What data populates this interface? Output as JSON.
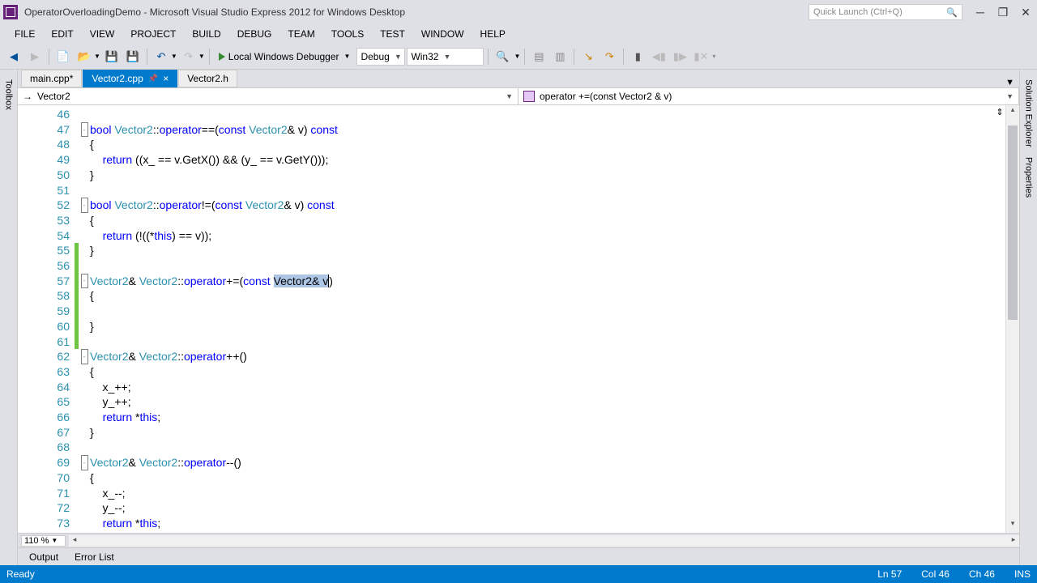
{
  "titlebar": {
    "title": "OperatorOverloadingDemo - Microsoft Visual Studio Express 2012 for Windows Desktop",
    "quicklaunch_placeholder": "Quick Launch (Ctrl+Q)"
  },
  "menu": [
    "FILE",
    "EDIT",
    "VIEW",
    "PROJECT",
    "BUILD",
    "DEBUG",
    "TEAM",
    "TOOLS",
    "TEST",
    "WINDOW",
    "HELP"
  ],
  "toolbar": {
    "debugger_label": "Local Windows Debugger",
    "config": "Debug",
    "platform": "Win32"
  },
  "left_panel": "Toolbox",
  "right_panels": [
    "Solution Explorer",
    "Properties"
  ],
  "tabs": [
    {
      "label": "main.cpp*",
      "active": false
    },
    {
      "label": "Vector2.cpp",
      "active": true,
      "pinned": true,
      "closable": true
    },
    {
      "label": "Vector2.h",
      "active": false
    }
  ],
  "nav": {
    "scope": "Vector2",
    "member": "operator +=(const Vector2 & v)"
  },
  "lines": [
    {
      "n": 46,
      "fold": "",
      "chg": "",
      "code": ""
    },
    {
      "n": 47,
      "fold": "-",
      "chg": "",
      "html": "<span class='kw'>bool</span> <span class='ty'>Vector2</span>::<span class='kw'>operator</span>==(<span class='kw'>const</span> <span class='ty'>Vector2</span>& v) <span class='kw'>const</span>"
    },
    {
      "n": 48,
      "fold": "",
      "chg": "",
      "code": "{"
    },
    {
      "n": 49,
      "fold": "",
      "chg": "",
      "html": "    <span class='kw'>return</span> ((x_ == v.GetX()) && (y_ == v.GetY()));"
    },
    {
      "n": 50,
      "fold": "",
      "chg": "",
      "code": "}"
    },
    {
      "n": 51,
      "fold": "",
      "chg": "",
      "code": ""
    },
    {
      "n": 52,
      "fold": "-",
      "chg": "",
      "html": "<span class='kw'>bool</span> <span class='ty'>Vector2</span>::<span class='kw'>operator</span>!=(<span class='kw'>const</span> <span class='ty'>Vector2</span>& v) <span class='kw'>const</span>"
    },
    {
      "n": 53,
      "fold": "",
      "chg": "",
      "code": "{"
    },
    {
      "n": 54,
      "fold": "",
      "chg": "",
      "html": "    <span class='kw'>return</span> (!((*<span class='kw'>this</span>) == v));"
    },
    {
      "n": 55,
      "fold": "",
      "chg": "g",
      "code": "}"
    },
    {
      "n": 56,
      "fold": "",
      "chg": "g",
      "code": ""
    },
    {
      "n": 57,
      "fold": "-",
      "chg": "g",
      "html": "<span class='ty'>Vector2</span>& <span class='ty'>Vector2</span>::<span class='kw'>operator</span>+=(<span class='kw'>const</span> <span class='sel'>Vector2& v</span><span class='cur'></span>)"
    },
    {
      "n": 58,
      "fold": "",
      "chg": "g",
      "code": "{"
    },
    {
      "n": 59,
      "fold": "",
      "chg": "g",
      "code": ""
    },
    {
      "n": 60,
      "fold": "",
      "chg": "g",
      "code": "}"
    },
    {
      "n": 61,
      "fold": "",
      "chg": "g",
      "code": ""
    },
    {
      "n": 62,
      "fold": "-",
      "chg": "",
      "html": "<span class='ty'>Vector2</span>& <span class='ty'>Vector2</span>::<span class='kw'>operator</span>++()"
    },
    {
      "n": 63,
      "fold": "",
      "chg": "",
      "code": "{"
    },
    {
      "n": 64,
      "fold": "",
      "chg": "",
      "code": "    x_++;"
    },
    {
      "n": 65,
      "fold": "",
      "chg": "",
      "code": "    y_++;"
    },
    {
      "n": 66,
      "fold": "",
      "chg": "",
      "html": "    <span class='kw'>return</span> *<span class='kw'>this</span>;"
    },
    {
      "n": 67,
      "fold": "",
      "chg": "",
      "code": "}"
    },
    {
      "n": 68,
      "fold": "",
      "chg": "",
      "code": ""
    },
    {
      "n": 69,
      "fold": "-",
      "chg": "",
      "html": "<span class='ty'>Vector2</span>& <span class='ty'>Vector2</span>::<span class='kw'>operator</span>--()"
    },
    {
      "n": 70,
      "fold": "",
      "chg": "",
      "code": "{"
    },
    {
      "n": 71,
      "fold": "",
      "chg": "",
      "code": "    x_--;"
    },
    {
      "n": 72,
      "fold": "",
      "chg": "",
      "code": "    y_--;"
    },
    {
      "n": 73,
      "fold": "",
      "chg": "",
      "html": "    <span class='kw'>return</span> *<span class='kw'>this</span>;"
    }
  ],
  "zoom": "110 %",
  "bottom_tabs": [
    "Output",
    "Error List"
  ],
  "status": {
    "ready": "Ready",
    "line": "Ln 57",
    "col": "Col 46",
    "ch": "Ch 46",
    "ins": "INS"
  }
}
